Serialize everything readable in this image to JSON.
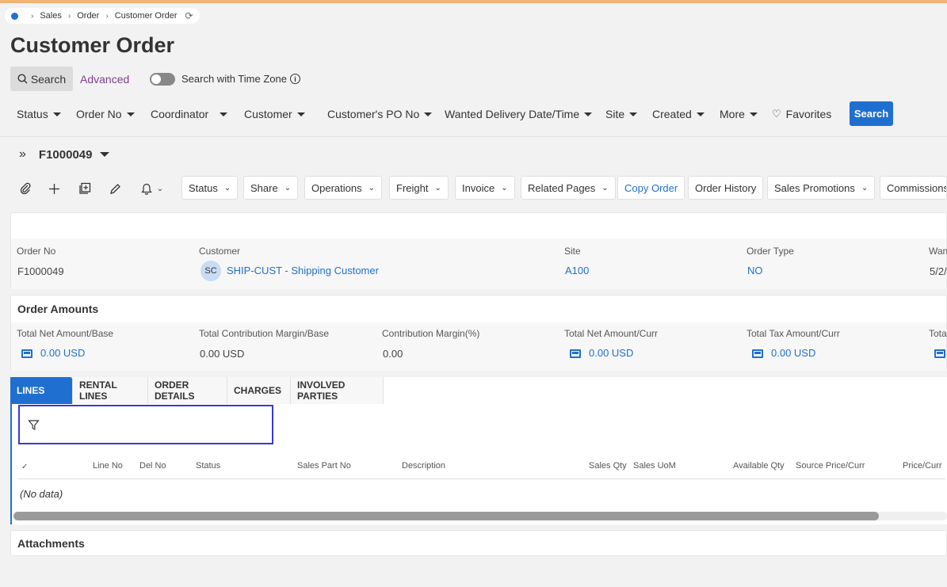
{
  "breadcrumb": {
    "items": [
      "Sales",
      "Order",
      "Customer Order"
    ]
  },
  "page_title": "Customer Order",
  "search_bar": {
    "search_label": "Search",
    "advanced_label": "Advanced",
    "timezone_label": "Search with Time Zone"
  },
  "filters": {
    "items": [
      "Status",
      "Order No",
      "Coordinator",
      "Customer",
      "Customer's PO No",
      "Wanted Delivery Date/Time",
      "Site",
      "Created",
      "More"
    ],
    "favorites_label": "Favorites",
    "search_button": "Search"
  },
  "record": {
    "id": "F1000049"
  },
  "toolbar": {
    "buttons": [
      "Status",
      "Share",
      "Operations",
      "Freight",
      "Invoice",
      "Related Pages",
      "Copy Order",
      "Order History",
      "Sales Promotions",
      "Commissions"
    ]
  },
  "header": {
    "order_no_label": "Order No",
    "order_no": "F1000049",
    "customer_label": "Customer",
    "customer_avatar": "SC",
    "customer": "SHIP-CUST - Shipping Customer",
    "site_label": "Site",
    "site": "A100",
    "order_type_label": "Order Type",
    "order_type": "NO",
    "wanted_label": "Wan",
    "wanted_value": "5/2/"
  },
  "amounts": {
    "title": "Order Amounts",
    "total_net_base_label": "Total Net Amount/Base",
    "total_net_base": "0.00 USD",
    "contribution_margin_base_label": "Total Contribution Margin/Base",
    "contribution_margin_base": "0.00 USD",
    "contribution_margin_pct_label": "Contribution Margin(%)",
    "contribution_margin_pct": "0.00",
    "total_net_curr_label": "Total Net Amount/Curr",
    "total_net_curr": "0.00 USD",
    "total_tax_curr_label": "Total Tax Amount/Curr",
    "total_tax_curr": "0.00 USD",
    "total_cut_label": "Tota"
  },
  "tabs": [
    "LINES",
    "RENTAL LINES",
    "ORDER DETAILS",
    "CHARGES",
    "INVOLVED PARTIES"
  ],
  "lines_table": {
    "columns": [
      "Line No",
      "Del No",
      "Status",
      "Sales Part No",
      "Description",
      "Sales Qty",
      "Sales UoM",
      "Available Qty",
      "Source Price/Curr",
      "Price/Curr"
    ],
    "empty_text": "(No data)"
  },
  "attachments": {
    "title": "Attachments"
  },
  "colors": {
    "accent": "#1f6fd0",
    "advanced": "#7b3f8c",
    "topbar": "#f0b476"
  }
}
